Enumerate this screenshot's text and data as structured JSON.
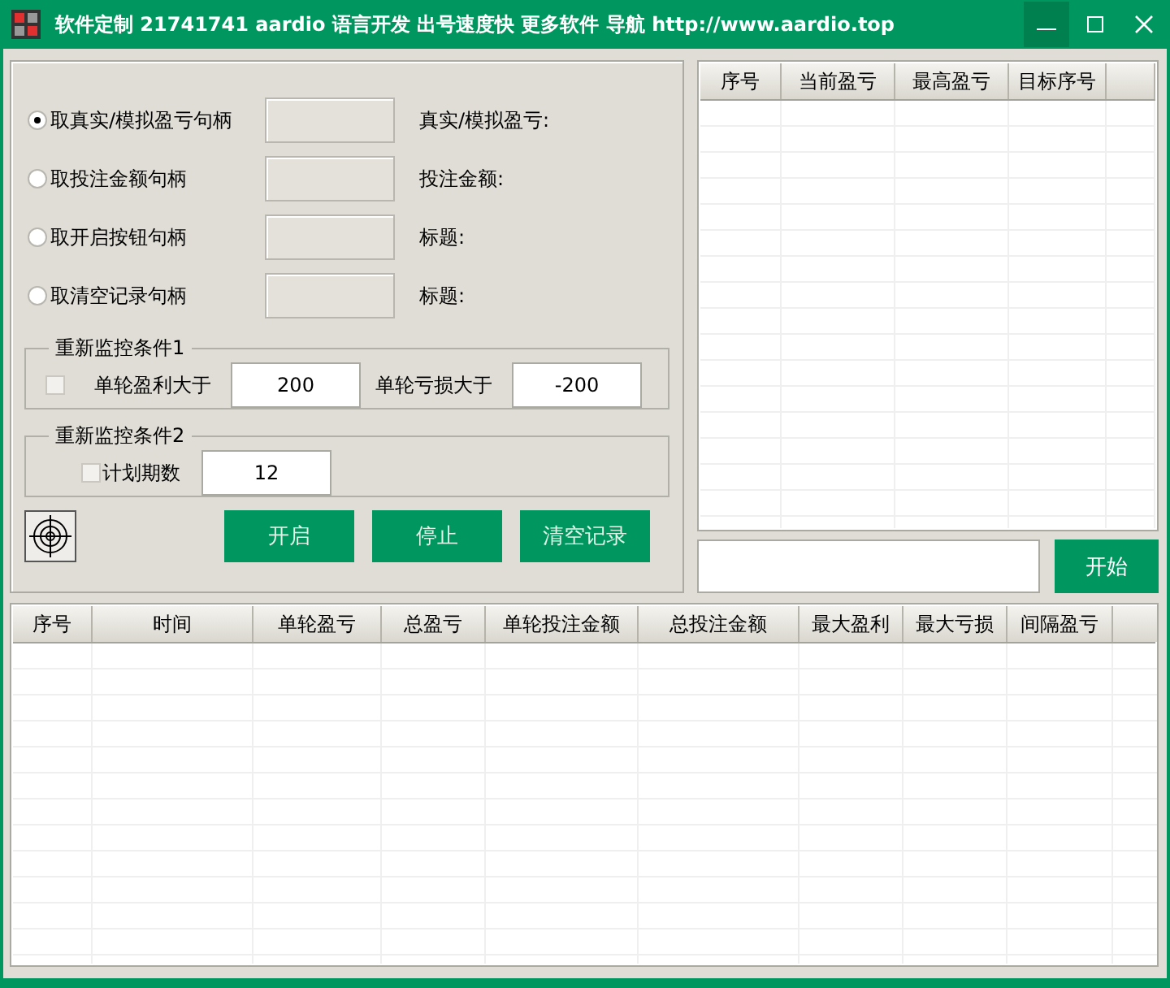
{
  "window": {
    "title": "软件定制 21741741 aardio 语言开发 出号速度快 更多软件 导航 http://www.aardio.top"
  },
  "handles": [
    {
      "label": "取真实/模拟盈亏句柄",
      "selected": true,
      "caption": "真实/模拟盈亏:"
    },
    {
      "label": "取投注金额句柄",
      "selected": false,
      "caption": "投注金额:"
    },
    {
      "label": "取开启按钮句柄",
      "selected": false,
      "caption": "标题:"
    },
    {
      "label": "取清空记录句柄",
      "selected": false,
      "caption": "标题:"
    }
  ],
  "condition_1": {
    "legend": "重新监控条件1",
    "checked": false,
    "profit_label": "单轮盈利大于",
    "profit_value": "200",
    "loss_label": "单轮亏损大于",
    "loss_value": "-200"
  },
  "condition_2": {
    "legend": "重新监控条件2",
    "checked": false,
    "periods_label": "计划期数",
    "periods_value": "12"
  },
  "buttons": [
    "开启",
    "停止",
    "清空记录"
  ],
  "target_table": {
    "columns": [
      "序号",
      "当前盈亏",
      "最高盈亏",
      "目标序号"
    ]
  },
  "start_button": "开始",
  "log_table": {
    "columns": [
      "序号",
      "时间",
      "单轮盈亏",
      "总盈亏",
      "单轮投注金额",
      "总投注金额",
      "最大盈利",
      "最大亏损",
      "间隔盈亏"
    ]
  }
}
